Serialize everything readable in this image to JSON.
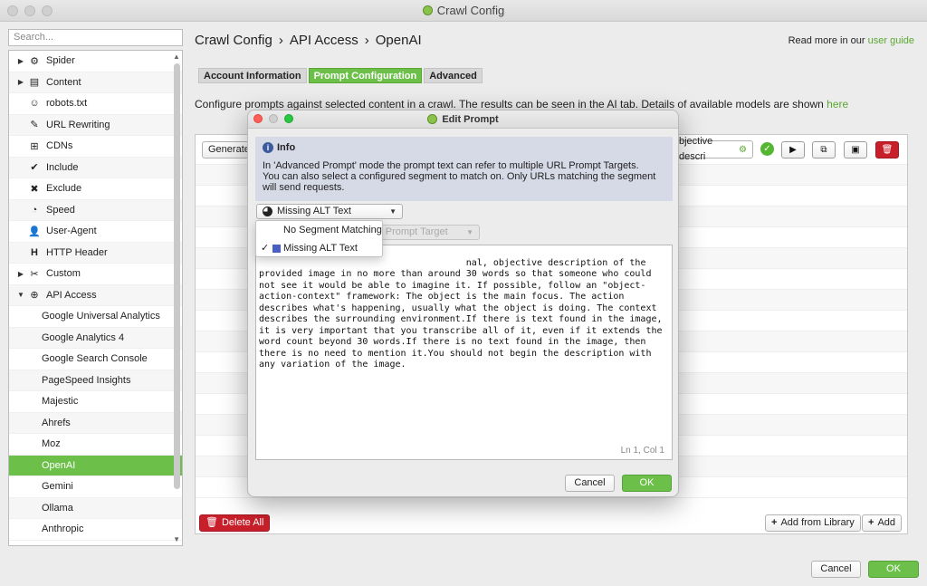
{
  "window": {
    "title": "Crawl Config"
  },
  "search": {
    "placeholder": "Search..."
  },
  "sidebar": {
    "items": [
      {
        "label": "Spider",
        "expandable": true,
        "expanded": false,
        "icon": "gear-icon"
      },
      {
        "label": "Content",
        "expandable": true,
        "expanded": false,
        "icon": "content-icon"
      },
      {
        "label": "robots.txt",
        "icon": "robot-icon"
      },
      {
        "label": "URL Rewriting",
        "icon": "edit-icon"
      },
      {
        "label": "CDNs",
        "icon": "network-icon"
      },
      {
        "label": "Include",
        "icon": "check-circle-icon"
      },
      {
        "label": "Exclude",
        "icon": "x-circle-icon"
      },
      {
        "label": "Speed",
        "icon": "speed-icon"
      },
      {
        "label": "User-Agent",
        "icon": "user-agent-icon"
      },
      {
        "label": "HTTP Header",
        "icon": "h-icon"
      },
      {
        "label": "Custom",
        "expandable": true,
        "expanded": false,
        "icon": "tools-icon"
      },
      {
        "label": "API Access",
        "expandable": true,
        "expanded": true,
        "icon": "globe-icon"
      }
    ],
    "sub_items": [
      "Google Universal Analytics",
      "Google Analytics 4",
      "Google Search Console",
      "PageSpeed Insights",
      "Majestic",
      "Ahrefs",
      "Moz",
      "OpenAI",
      "Gemini",
      "Ollama",
      "Anthropic"
    ],
    "active": "OpenAI"
  },
  "breadcrumb": {
    "part1": "Crawl Config",
    "part2": "API Access",
    "part3": "OpenAI",
    "sep": "›"
  },
  "readmore": {
    "prefix": "Read more in our ",
    "link": "user guide"
  },
  "tabs": [
    "Account Information",
    "Prompt Configuration",
    "Advanced"
  ],
  "active_tab": "Prompt Configuration",
  "description": {
    "text": "Configure prompts against selected content in a crawl. The results can be seen in the AI tab. Details of available models are shown ",
    "link": "here"
  },
  "toolbar": {
    "generate": "Generate",
    "prompt_preview": "bjective descri"
  },
  "bottom": {
    "delete_all": "Delete All",
    "add_from_library": "Add from Library",
    "add": "Add",
    "cancel": "Cancel",
    "ok": "OK"
  },
  "modal": {
    "title": "Edit Prompt",
    "info_heading": "Info",
    "info_line1": "In 'Advanced Prompt' mode the prompt text can refer to multiple URL Prompt Targets.",
    "info_line2": "You can also select a configured segment to match on. Only URLs matching the segment will send requests.",
    "segment_selected": "Missing ALT Text",
    "target_placeholder": "rt Prompt Target",
    "prompt_text": "                                  nal, objective description of the provided image in no more than around 30 words so that someone who could not see it would be able to imagine it. If possible, follow an \"object-action-context\" framework: The object is the main focus. The action describes what's happening, usually what the object is doing. The context describes the surrounding environment.If there is text found in the image, it is very important that you transcribe all of it, even if it extends the word count beyond 30 words.If there is no text found in the image, then there is no need to mention it.You should not begin the description with any variation of the image.",
    "cursor_position": "Ln 1, Col 1",
    "cancel": "Cancel",
    "ok": "OK"
  },
  "dropdown": {
    "options": [
      "No Segment Matching",
      "Missing ALT Text"
    ],
    "selected": "Missing ALT Text",
    "check_mark": "✓",
    "swatch_color": "#4a5fc2"
  },
  "colors": {
    "accent": "#6cc04a",
    "danger": "#c8202b",
    "link": "#5aa832"
  }
}
